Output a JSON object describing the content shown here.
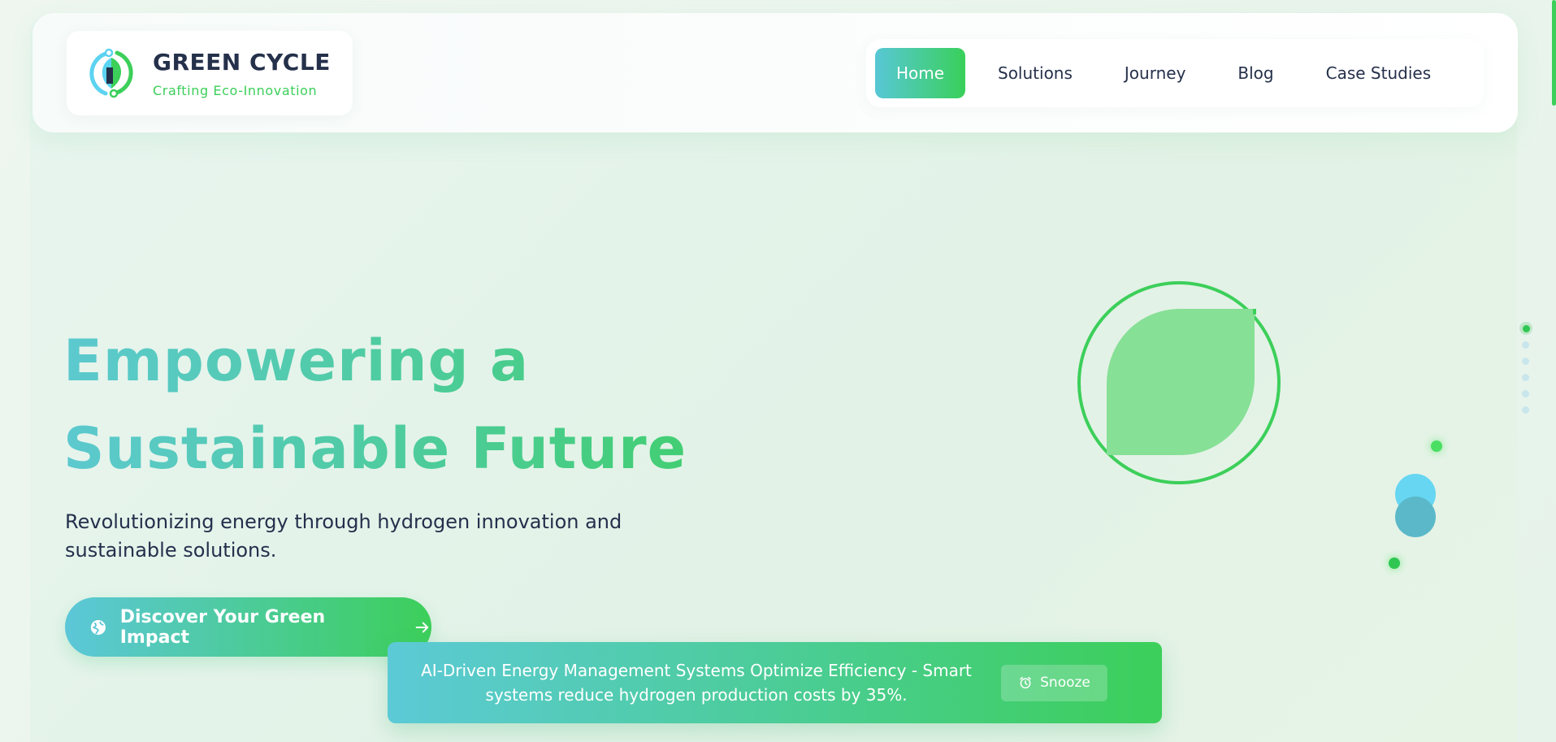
{
  "brand": {
    "name": "GREEN CYCLE",
    "tagline": "Crafting Eco-Innovation"
  },
  "nav": {
    "items": [
      {
        "label": "Home",
        "active": true
      },
      {
        "label": "Solutions",
        "active": false
      },
      {
        "label": "Journey",
        "active": false
      },
      {
        "label": "Blog",
        "active": false
      },
      {
        "label": "Case Studies",
        "active": false
      }
    ]
  },
  "hero": {
    "title_line1": "Empowering a",
    "title_line2": "Sustainable Future",
    "subtitle": "Revolutionizing energy through hydrogen innovation and sustainable solutions.",
    "cta_label": "Discover Your Green Impact",
    "cta_icon": "globe-icon",
    "cta_arrow_icon": "arrow-right-icon"
  },
  "decorations": {
    "leaf_icon": "leaf-icon"
  },
  "slide_indicator": {
    "count": 6,
    "active_index": 0
  },
  "toast": {
    "message": "AI-Driven Energy Management Systems Optimize Efficiency - Smart systems reduce hydrogen production costs by 35%.",
    "snooze_label": "Snooze",
    "snooze_icon": "alarm-clock-icon"
  },
  "colors": {
    "accent_teal": "#5cc9d4",
    "accent_green": "#3ccf5a",
    "text_dark": "#25304a",
    "background": "#e6f3ea"
  }
}
